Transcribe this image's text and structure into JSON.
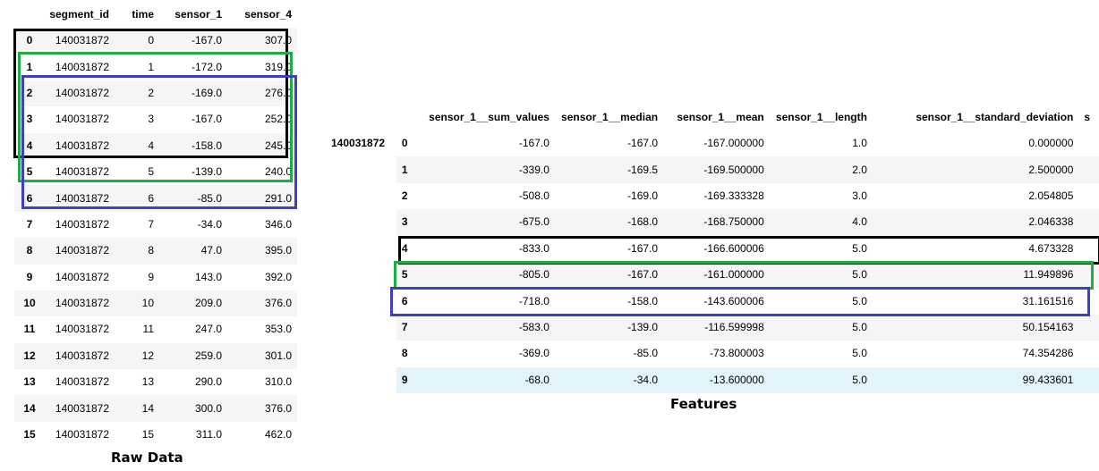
{
  "raw_data": {
    "caption": "Raw Data",
    "columns": [
      "segment_id",
      "time",
      "sensor_1",
      "sensor_4"
    ],
    "rows": [
      [
        "0",
        "140031872",
        "0",
        "-167.0",
        "307.0"
      ],
      [
        "1",
        "140031872",
        "1",
        "-172.0",
        "319.0"
      ],
      [
        "2",
        "140031872",
        "2",
        "-169.0",
        "276.0"
      ],
      [
        "3",
        "140031872",
        "3",
        "-167.0",
        "252.0"
      ],
      [
        "4",
        "140031872",
        "4",
        "-158.0",
        "245.0"
      ],
      [
        "5",
        "140031872",
        "5",
        "-139.0",
        "240.0"
      ],
      [
        "6",
        "140031872",
        "6",
        "-85.0",
        "291.0"
      ],
      [
        "7",
        "140031872",
        "7",
        "-34.0",
        "346.0"
      ],
      [
        "8",
        "140031872",
        "8",
        "47.0",
        "395.0"
      ],
      [
        "9",
        "140031872",
        "9",
        "143.0",
        "392.0"
      ],
      [
        "10",
        "140031872",
        "10",
        "209.0",
        "376.0"
      ],
      [
        "11",
        "140031872",
        "11",
        "247.0",
        "353.0"
      ],
      [
        "12",
        "140031872",
        "12",
        "259.0",
        "301.0"
      ],
      [
        "13",
        "140031872",
        "13",
        "290.0",
        "310.0"
      ],
      [
        "14",
        "140031872",
        "14",
        "300.0",
        "376.0"
      ],
      [
        "15",
        "140031872",
        "15",
        "311.0",
        "462.0"
      ]
    ]
  },
  "features": {
    "caption": "Features",
    "segment": "140031872",
    "columns": [
      "sensor_1__sum_values",
      "sensor_1__median",
      "sensor_1__mean",
      "sensor_1__length",
      "sensor_1__standard_deviation",
      "s"
    ],
    "rows": [
      [
        "0",
        "-167.0",
        "-167.0",
        "-167.000000",
        "1.0",
        "0.000000"
      ],
      [
        "1",
        "-339.0",
        "-169.5",
        "-169.500000",
        "2.0",
        "2.500000"
      ],
      [
        "2",
        "-508.0",
        "-169.0",
        "-169.333328",
        "3.0",
        "2.054805"
      ],
      [
        "3",
        "-675.0",
        "-168.0",
        "-168.750000",
        "4.0",
        "2.046338"
      ],
      [
        "4",
        "-833.0",
        "-167.0",
        "-166.600006",
        "5.0",
        "4.673328"
      ],
      [
        "5",
        "-805.0",
        "-167.0",
        "-161.000000",
        "5.0",
        "11.949896"
      ],
      [
        "6",
        "-718.0",
        "-158.0",
        "-143.600006",
        "5.0",
        "31.161516"
      ],
      [
        "7",
        "-583.0",
        "-139.0",
        "-116.599998",
        "5.0",
        "50.154163"
      ],
      [
        "8",
        "-369.0",
        "-85.0",
        "-73.800003",
        "5.0",
        "74.354286"
      ],
      [
        "9",
        "-68.0",
        "-34.0",
        "-13.600000",
        "5.0",
        "99.433601"
      ]
    ]
  },
  "highlight_colors": {
    "black": "#000000",
    "green": "#22aa44",
    "blue": "#3f3fbf",
    "hover_row": "#e1f4fb"
  }
}
